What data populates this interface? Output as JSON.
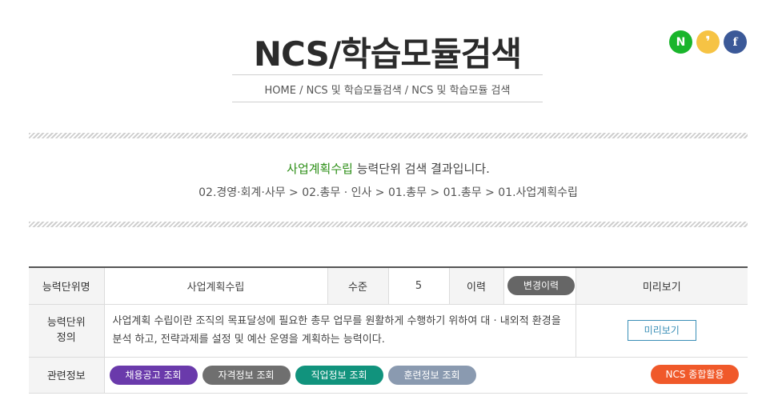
{
  "header": {
    "title": "NCS/학습모듈검색",
    "breadcrumb": "HOME / NCS 및 학습모듈검색 / NCS 및 학습모듈 검색"
  },
  "share": {
    "naver": "N",
    "kakao": "❜",
    "facebook": "f",
    "naver_icon": "naver-icon",
    "kakao_icon": "kakao-icon",
    "facebook_icon": "facebook-icon"
  },
  "result": {
    "keyword": "사업계획수립",
    "suffix": " 능력단위 검색 결과입니다.",
    "path": "02.경영·회계·사무 > 02.총무 · 인사 > 01.총무 > 01.총무 > 01.사업계획수립"
  },
  "table": {
    "unit_name_label": "능력단위명",
    "unit_name_value": "사업계획수립",
    "level_label": "수준",
    "level_value": "5",
    "history_label": "이력",
    "history_button": "변경이력",
    "preview_header": "미리보기",
    "definition_label": "능력단위\n정의",
    "definition_text": "사업계획 수립이란 조직의 목표달성에 필요한 총무 업무를 원활하게 수행하기 위하여 대 · 내외적 환경을 분석 하고, 전략과제를 설정 및 예산 운영을 계획하는 능력이다.",
    "preview_button": "미리보기",
    "related_label": "관련정보",
    "related_buttons": [
      "채용공고 조회",
      "자격정보 조회",
      "직업정보 조회",
      "훈련정보 조회"
    ],
    "ncs_button": "NCS 종합활용"
  },
  "colors": {
    "keyword": "#2d8f17",
    "purple": "#6a3aab",
    "gray": "#6f6f6f",
    "teal": "#11937d",
    "slate": "#8a9ab0",
    "orange": "#f0592a",
    "outline": "#3a8fb7"
  }
}
